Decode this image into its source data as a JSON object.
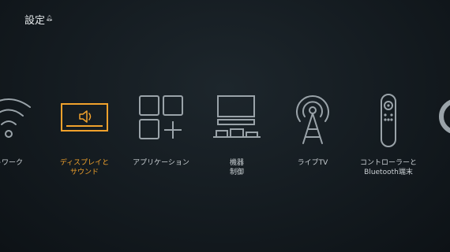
{
  "header": {
    "title": "設定",
    "notification_icon": "bell-icon"
  },
  "accent_color": "#f1a22c",
  "tiles": [
    {
      "icon": "wifi-icon",
      "lines": [
        "トワーク"
      ],
      "focused": false
    },
    {
      "icon": "display-sound-icon",
      "lines": [
        "ディスプレイと",
        "サウンド"
      ],
      "focused": true
    },
    {
      "icon": "apps-grid-icon",
      "lines": [
        "アプリケーション"
      ],
      "focused": false
    },
    {
      "icon": "equipment-control-icon",
      "lines": [
        "機器",
        "制御"
      ],
      "focused": false
    },
    {
      "icon": "antenna-icon",
      "lines": [
        "ライブTV"
      ],
      "focused": false
    },
    {
      "icon": "remote-icon",
      "lines": [
        "コントローラーと",
        "Bluetooth端末"
      ],
      "focused": false
    },
    {
      "icon": "partial-icon",
      "lines": [],
      "focused": false
    }
  ]
}
